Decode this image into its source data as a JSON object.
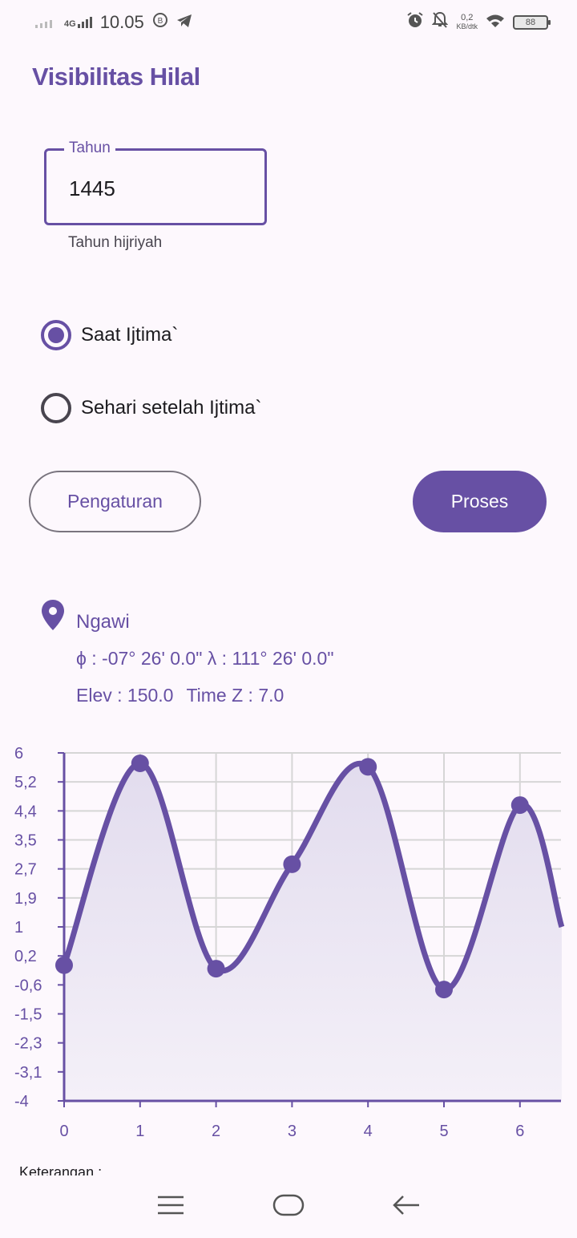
{
  "status_bar": {
    "network": "4G",
    "time": "10.05",
    "speed_value": "0,2",
    "speed_unit": "KB/dtk",
    "battery": "88"
  },
  "app": {
    "title": "Visibilitas Hilal"
  },
  "year_field": {
    "label": "Tahun",
    "value": "1445",
    "helper": "Tahun hijriyah"
  },
  "options": [
    {
      "label": "Saat Ijtima`",
      "selected": true
    },
    {
      "label": "Sehari setelah Ijtima`",
      "selected": false
    }
  ],
  "buttons": {
    "settings": "Pengaturan",
    "process": "Proses"
  },
  "location": {
    "name": "Ngawi",
    "coords": "ϕ : -07° 26' 0.0\" λ : 111° 26' 0.0\"",
    "elev": "Elev : 150.0",
    "timezone": "Time Z : 7.0"
  },
  "colors": {
    "accent": "#6750a4",
    "grid": "#d6d6d6",
    "fill": "#e2dcee"
  },
  "chart_data": {
    "type": "area",
    "x": [
      0,
      1,
      2,
      3,
      4,
      5,
      6,
      6.55
    ],
    "y": [
      -0.1,
      5.7,
      -0.2,
      2.8,
      5.6,
      -0.8,
      4.5,
      1.0
    ],
    "points_marked": [
      0,
      1,
      2,
      3,
      4,
      5,
      6
    ],
    "x_ticks": [
      "0",
      "1",
      "2",
      "3",
      "4",
      "5",
      "6"
    ],
    "y_ticks": [
      "6",
      "5,2",
      "4,4",
      "3,5",
      "2,7",
      "1,9",
      "1",
      "0,2",
      "-0,6",
      "-1,5",
      "-2,3",
      "-3,1",
      "-4"
    ],
    "ylim": [
      -4,
      6
    ],
    "xlim": [
      0,
      6.55
    ],
    "grid": true,
    "title": "",
    "xlabel": "",
    "ylabel": ""
  },
  "footer": {
    "note": "Keterangan :"
  }
}
